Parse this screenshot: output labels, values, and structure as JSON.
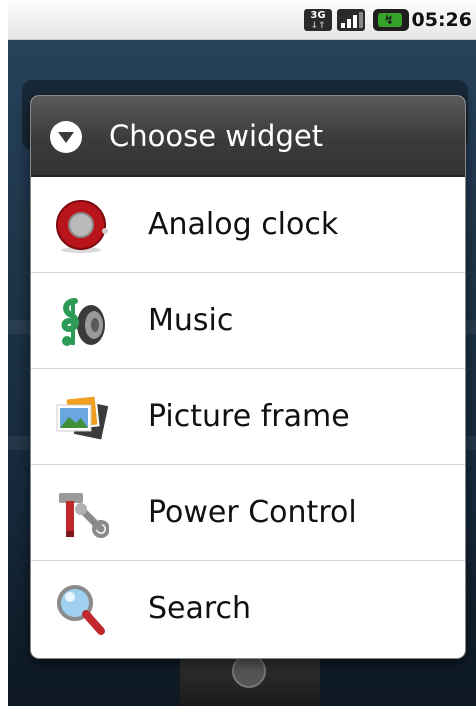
{
  "status_bar": {
    "network_label": "3G",
    "time": "05:26"
  },
  "dialog": {
    "title": "Choose widget",
    "items": [
      {
        "label": "Analog clock",
        "icon": "analog-clock-icon"
      },
      {
        "label": "Music",
        "icon": "music-icon"
      },
      {
        "label": "Picture frame",
        "icon": "picture-frame-icon"
      },
      {
        "label": "Power Control",
        "icon": "power-control-icon"
      },
      {
        "label": "Search",
        "icon": "search-icon"
      }
    ]
  },
  "colors": {
    "header_bg": "#3b3b3b",
    "list_bg": "#ffffff",
    "battery_green": "#35a32a",
    "home_bg": "#1d3448"
  }
}
